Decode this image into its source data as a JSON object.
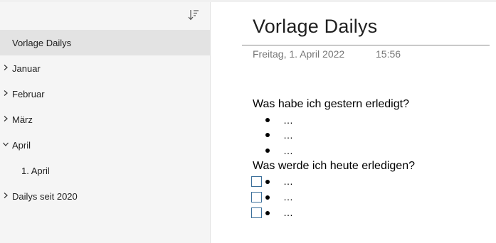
{
  "sidebar": {
    "sort_icon": "sort-descending-icon",
    "items": [
      {
        "label": "Vorlage Dailys",
        "selected": true,
        "chevron": "none"
      },
      {
        "label": "Januar",
        "chevron": "chevron-right"
      },
      {
        "label": "Februar",
        "chevron": "chevron-right"
      },
      {
        "label": "März",
        "chevron": "chevron-right"
      },
      {
        "label": "April",
        "chevron": "chevron-down"
      },
      {
        "label": "1. April",
        "chevron": "none"
      },
      {
        "label": "Dailys seit 2020",
        "chevron": "chevron-right"
      }
    ]
  },
  "page": {
    "title": "Vorlage Dailys",
    "date": "Freitag, 1. April 2022",
    "time": "15:56",
    "section1": {
      "heading": "Was habe ich gestern erledigt?",
      "bullets": [
        "…",
        "…",
        "…"
      ]
    },
    "section2": {
      "heading": "Was werde ich heute erledigen?",
      "todos": [
        {
          "text": "…",
          "checked": false
        },
        {
          "text": "…",
          "checked": false
        },
        {
          "text": "…",
          "checked": false
        }
      ]
    }
  },
  "colors": {
    "sidebar_bg": "#f5f5f5",
    "selected_bg": "#e3e3e3",
    "meta_text": "#767676",
    "checkbox_border": "#3b6f9a"
  }
}
